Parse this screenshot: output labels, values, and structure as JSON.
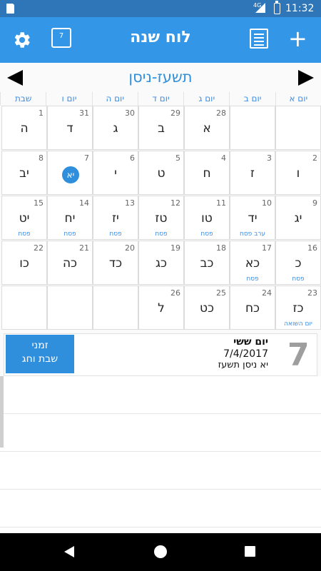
{
  "status_bar": {
    "network": "4G",
    "time": "11:32"
  },
  "app_bar": {
    "title": "לוח שנה",
    "date_icon_label": "7"
  },
  "month_nav": {
    "title": "תשעז-ניסן"
  },
  "weekdays": [
    "יום א",
    "יום ב",
    "יום ג",
    "יום ד",
    "יום ה",
    "יום ו",
    "שבת"
  ],
  "weeks": [
    [
      {
        "greg": "",
        "heb": "",
        "event": ""
      },
      {
        "greg": "",
        "heb": "",
        "event": ""
      },
      {
        "greg": "28",
        "heb": "א",
        "event": ""
      },
      {
        "greg": "29",
        "heb": "ב",
        "event": ""
      },
      {
        "greg": "30",
        "heb": "ג",
        "event": ""
      },
      {
        "greg": "31",
        "heb": "ד",
        "event": ""
      },
      {
        "greg": "1",
        "heb": "ה",
        "event": ""
      }
    ],
    [
      {
        "greg": "2",
        "heb": "ו",
        "event": ""
      },
      {
        "greg": "3",
        "heb": "ז",
        "event": ""
      },
      {
        "greg": "4",
        "heb": "ח",
        "event": ""
      },
      {
        "greg": "5",
        "heb": "ט",
        "event": ""
      },
      {
        "greg": "6",
        "heb": "י",
        "event": ""
      },
      {
        "greg": "7",
        "heb": "יא",
        "event": "",
        "today": true
      },
      {
        "greg": "8",
        "heb": "יב",
        "event": ""
      }
    ],
    [
      {
        "greg": "9",
        "heb": "יג",
        "event": ""
      },
      {
        "greg": "10",
        "heb": "יד",
        "event": "ערב פסח"
      },
      {
        "greg": "11",
        "heb": "טו",
        "event": "פסח"
      },
      {
        "greg": "12",
        "heb": "טז",
        "event": "פסח"
      },
      {
        "greg": "13",
        "heb": "יז",
        "event": "פסח"
      },
      {
        "greg": "14",
        "heb": "יח",
        "event": "פסח"
      },
      {
        "greg": "15",
        "heb": "יט",
        "event": "פסח"
      }
    ],
    [
      {
        "greg": "16",
        "heb": "כ",
        "event": "פסח"
      },
      {
        "greg": "17",
        "heb": "כא",
        "event": "פסח"
      },
      {
        "greg": "18",
        "heb": "כב",
        "event": ""
      },
      {
        "greg": "19",
        "heb": "כג",
        "event": ""
      },
      {
        "greg": "20",
        "heb": "כד",
        "event": ""
      },
      {
        "greg": "21",
        "heb": "כה",
        "event": ""
      },
      {
        "greg": "22",
        "heb": "כו",
        "event": ""
      }
    ],
    [
      {
        "greg": "23",
        "heb": "כז",
        "event": "יום השואה"
      },
      {
        "greg": "24",
        "heb": "כח",
        "event": ""
      },
      {
        "greg": "25",
        "heb": "כט",
        "event": ""
      },
      {
        "greg": "26",
        "heb": "ל",
        "event": ""
      },
      {
        "greg": "",
        "heb": "",
        "event": ""
      },
      {
        "greg": "",
        "heb": "",
        "event": ""
      },
      {
        "greg": "",
        "heb": "",
        "event": ""
      }
    ]
  ],
  "detail": {
    "day_name": "יום ששי",
    "greg_date": "7/4/2017",
    "heb_date": "יא ניסן תשעז",
    "big_day": "7",
    "shabbat_button_line1": "זמני",
    "shabbat_button_line2": "שבת וחג"
  },
  "colors": {
    "primary": "#3396e6",
    "accent": "#2f8fdc",
    "status_bar": "#2f76b9"
  },
  "icons": {
    "settings": "gear-icon",
    "today": "calendar-date-icon",
    "list": "list-icon",
    "add": "plus-icon",
    "prev": "triangle-left-icon",
    "next": "triangle-right-icon"
  }
}
